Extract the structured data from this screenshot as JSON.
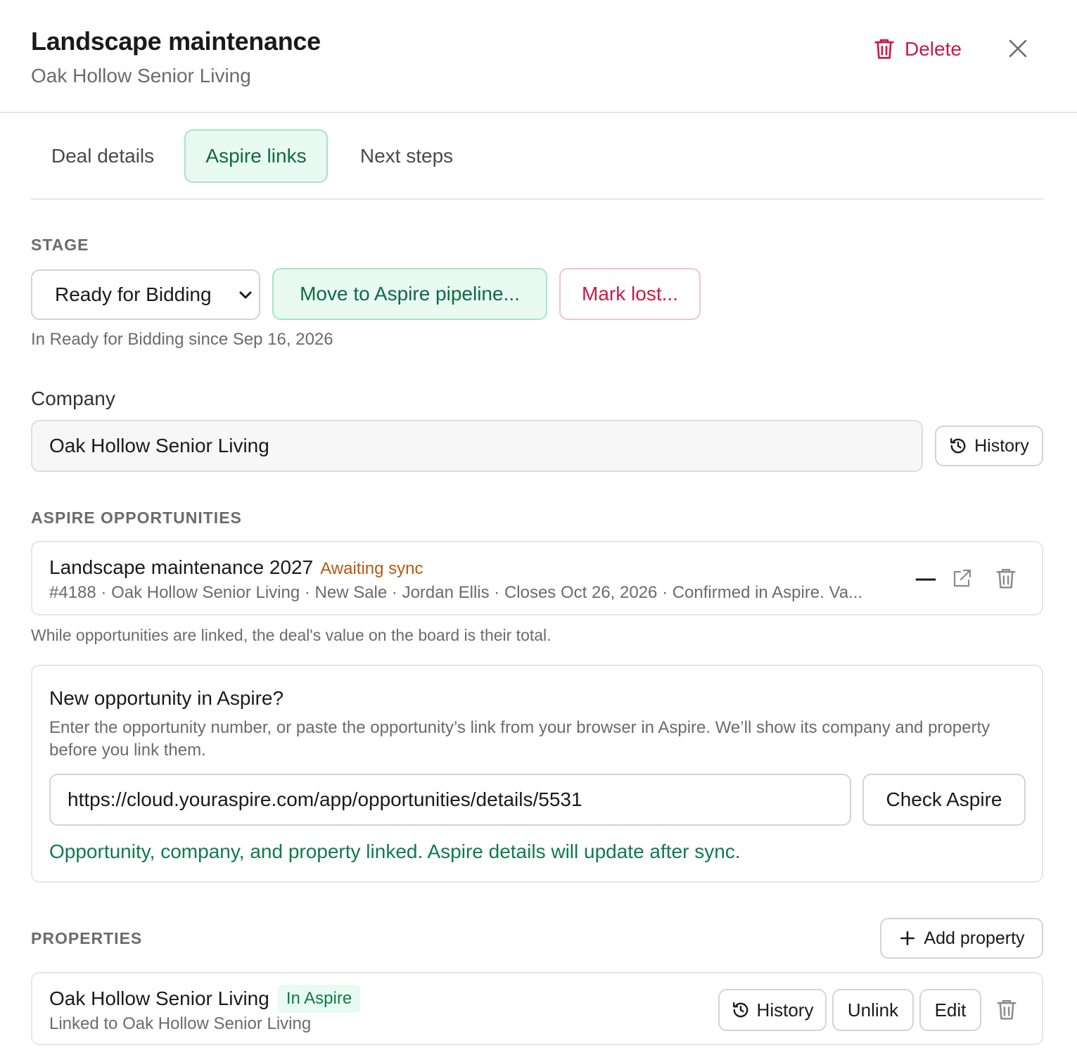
{
  "header": {
    "title": "Landscape maintenance",
    "subtitle": "Oak Hollow Senior Living",
    "delete_label": "Delete"
  },
  "tabs": [
    {
      "label": "Deal details",
      "active": false
    },
    {
      "label": "Aspire links",
      "active": true
    },
    {
      "label": "Next steps",
      "active": false
    }
  ],
  "stage": {
    "section_label": "STAGE",
    "selected": "Ready for Bidding",
    "move_label": "Move to Aspire pipeline...",
    "lost_label": "Mark lost...",
    "since_text": "In Ready for Bidding since Sep 16, 2026"
  },
  "company": {
    "label": "Company",
    "value": "Oak Hollow Senior Living",
    "history_label": "History"
  },
  "opportunities": {
    "section_label": "ASPIRE OPPORTUNITIES",
    "items": [
      {
        "title": "Landscape maintenance 2027",
        "status": "Awaiting sync",
        "meta": "#4188 · Oak Hollow Senior Living · New Sale · Jordan Ellis · Closes Oct 26, 2026 · Confirmed in Aspire. Va..."
      }
    ],
    "note": "While opportunities are linked, the deal's value on the board is their total."
  },
  "new_opportunity": {
    "title": "New opportunity in Aspire?",
    "description": "Enter the opportunity number, or paste the opportunity’s link from your browser in Aspire. We’ll show its company and property before you link them.",
    "input_value": "https://cloud.youraspire.com/app/opportunities/details/5531",
    "check_label": "Check Aspire",
    "success_message": "Opportunity, company, and property linked. Aspire details will update after sync."
  },
  "properties": {
    "section_label": "PROPERTIES",
    "add_label": "Add property",
    "items": [
      {
        "name": "Oak Hollow Senior Living",
        "badge": "In Aspire",
        "subtitle": "Linked to Oak Hollow Senior Living",
        "history_label": "History",
        "unlink_label": "Unlink",
        "edit_label": "Edit"
      }
    ]
  },
  "colors": {
    "accent_green": "#0f6a44",
    "danger_red": "#cc1a45",
    "warning_orange": "#b35a12"
  }
}
